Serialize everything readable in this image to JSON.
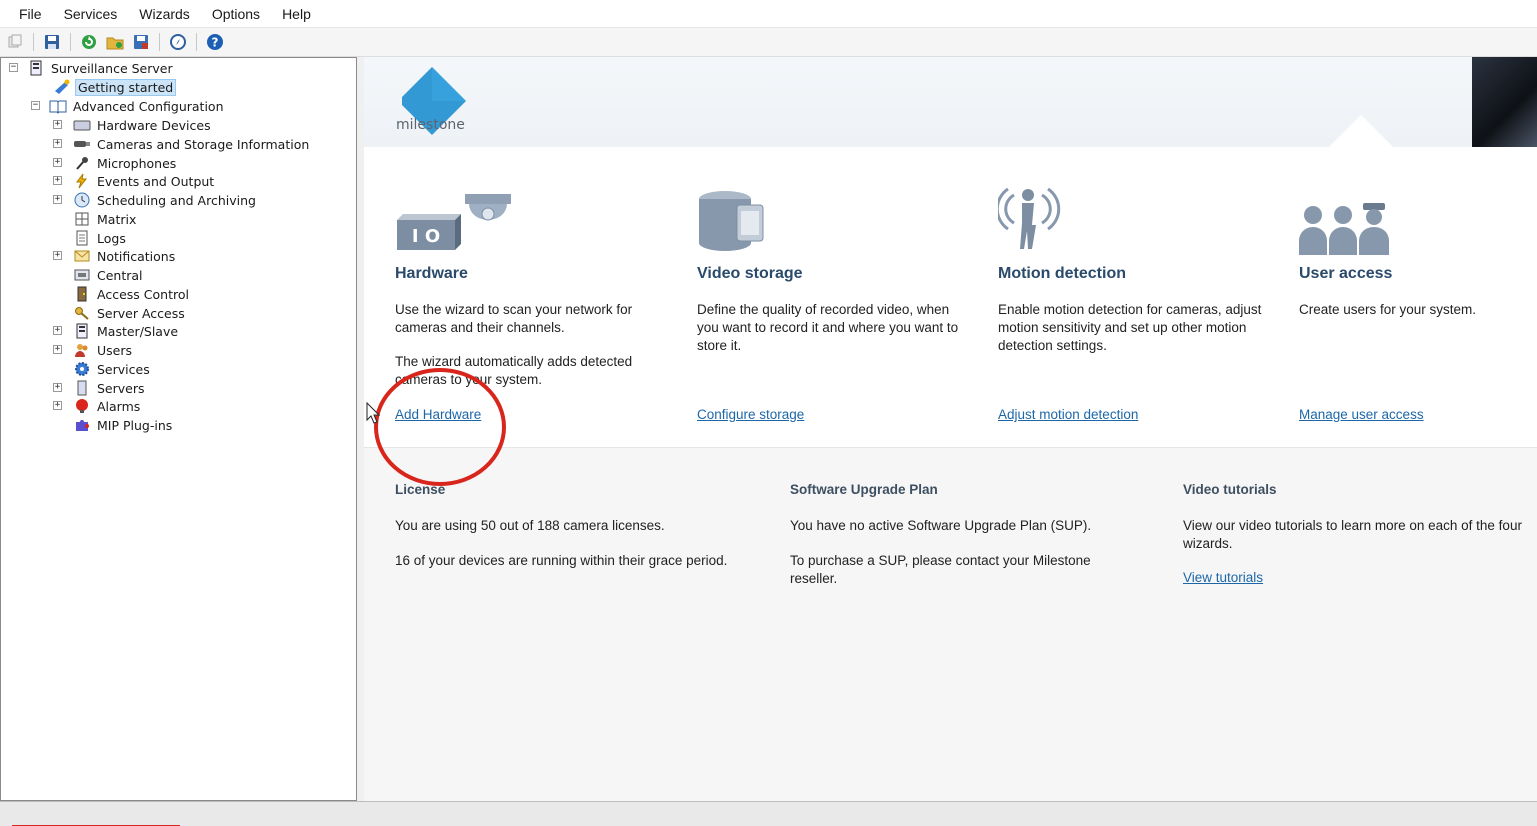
{
  "menu": {
    "items": [
      "File",
      "Services",
      "Wizards",
      "Options",
      "Help"
    ]
  },
  "toolbar": {
    "buttons": [
      "copy-icon",
      "save-icon",
      "refresh-icon",
      "open-folder-icon",
      "save-as-icon",
      "compass-icon",
      "help-icon"
    ]
  },
  "tree": {
    "root": "Surveillance Server",
    "getting_started": "Getting started",
    "advanced": "Advanced Configuration",
    "items": [
      "Hardware Devices",
      "Cameras and Storage Information",
      "Microphones",
      "Events and Output",
      "Scheduling and Archiving",
      "Matrix",
      "Logs",
      "Notifications",
      "Central",
      "Access Control",
      "Server Access",
      "Master/Slave",
      "Users",
      "Services",
      "Servers",
      "Alarms",
      "MIP Plug-ins"
    ]
  },
  "brand": {
    "logo_text": "milestone",
    "accent": "#1e8fd0"
  },
  "wizards": {
    "hardware": {
      "title": "Hardware",
      "desc": "Use the wizard to scan your network for cameras and their channels.",
      "desc2": "The wizard automatically adds detected cameras to your system.",
      "link": "Add Hardware"
    },
    "storage": {
      "title": "Video storage",
      "desc": "Define the quality of recorded video, when you want to record it and where you want to store it.",
      "link": "Configure storage"
    },
    "motion": {
      "title": "Motion detection",
      "desc": "Enable motion detection for cameras, adjust motion sensitivity and set up other motion detection settings.",
      "link": "Adjust motion detection"
    },
    "users": {
      "title": "User access",
      "desc": "Create users for your system.",
      "link": "Manage user access"
    }
  },
  "info": {
    "license": {
      "title": "License",
      "p1": "You are using 50 out of 188 camera licenses.",
      "p2": "16 of your devices are running within their grace period."
    },
    "sup": {
      "title": "Software Upgrade Plan",
      "p1": "You have no active Software Upgrade Plan (SUP).",
      "p2": "To purchase a SUP, please contact your Milestone reseller."
    },
    "tutorials": {
      "title": "Video tutorials",
      "p1": "View our video tutorials to learn more on each of the four wizards.",
      "link": "View tutorials"
    }
  }
}
